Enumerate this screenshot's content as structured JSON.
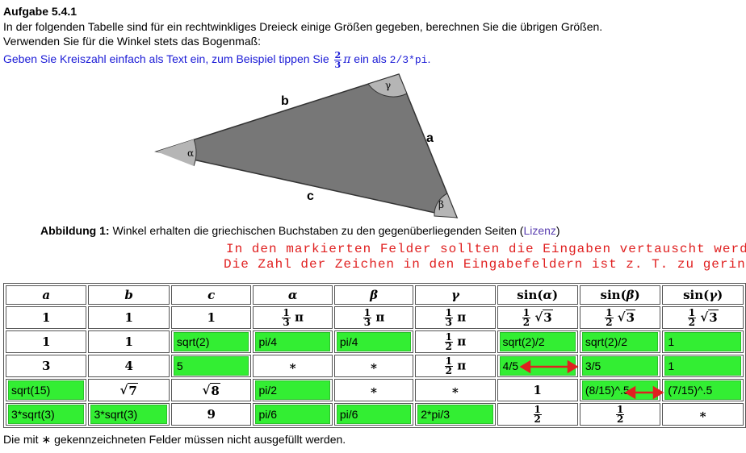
{
  "title": "Aufgabe 5.4.1",
  "intro": "In der folgenden Tabelle sind für ein rechtwinkliges Dreieck einige Größen gegeben, berechnen Sie die übrigen Größen. Verwenden Sie für die Winkel stets das Bogenmaß:",
  "hint": {
    "prefix": "Geben Sie Kreiszahl einfach als Text ein, zum Beispiel tippen Sie",
    "frac_num": "2",
    "frac_den": "3",
    "pi": "π",
    "middle": "ein als",
    "code": "2/3*pi",
    "suffix": "."
  },
  "figure": {
    "label_a": "a",
    "label_b": "b",
    "label_c": "c",
    "label_alpha": "α",
    "label_beta": "β",
    "label_gamma": "γ",
    "fill_color": "#777777"
  },
  "caption": {
    "bold": "Abbildung 1:",
    "text": "Winkel erhalten die griechischen Buchstaben zu den gegenüberliegenden Seiten (",
    "link": "Lizenz",
    "close": ")"
  },
  "annotation": {
    "line1": "In den markierten Felder sollten die Eingaben vertauscht werden.",
    "line2": "Die Zahl der Zeichen in den Eingabefeldern ist z. T. zu gering.",
    "color": "#e02020"
  },
  "table": {
    "headers": [
      "a",
      "b",
      "c",
      "α",
      "β",
      "γ",
      "sin(α)",
      "sin(β)",
      "sin(γ)"
    ],
    "sin_prefix": "sin(",
    "sin_suffix": ")",
    "sin_args": [
      "α",
      "β",
      "γ"
    ],
    "third": {
      "n": "1",
      "d": "3"
    },
    "half": {
      "n": "1",
      "d": "2"
    },
    "pi": "π",
    "sqrt3": "3",
    "sqrt7": "7",
    "sqrt8": "8",
    "star": "∗",
    "one": "1",
    "three": "3",
    "four": "4",
    "nine": "9",
    "inputs": {
      "r2_c": "sqrt(2)",
      "r2_alpha": "pi/4",
      "r2_beta": "pi/4",
      "r2_sina": "sqrt(2)/2",
      "r2_sinb": "sqrt(2)/2",
      "r2_sing": "1",
      "r3_c": "5",
      "r3_sina": "4/5",
      "r3_sinb": "3/5",
      "r3_sing": "1",
      "r4_a": "sqrt(15)",
      "r4_alpha": "pi/2",
      "r4_sinb": "(8/15)^.5",
      "r4_sing": "(7/15)^.5",
      "r5_a": "3*sqrt(3)",
      "r5_b": "3*sqrt(3)",
      "r5_alpha": "pi/6",
      "r5_beta": "pi/6",
      "r5_gamma": "2*pi/3"
    },
    "input_color": "#33ee33"
  },
  "footer": "Die mit ∗ gekennzeichneten Felder müssen nicht ausgefüllt werden."
}
